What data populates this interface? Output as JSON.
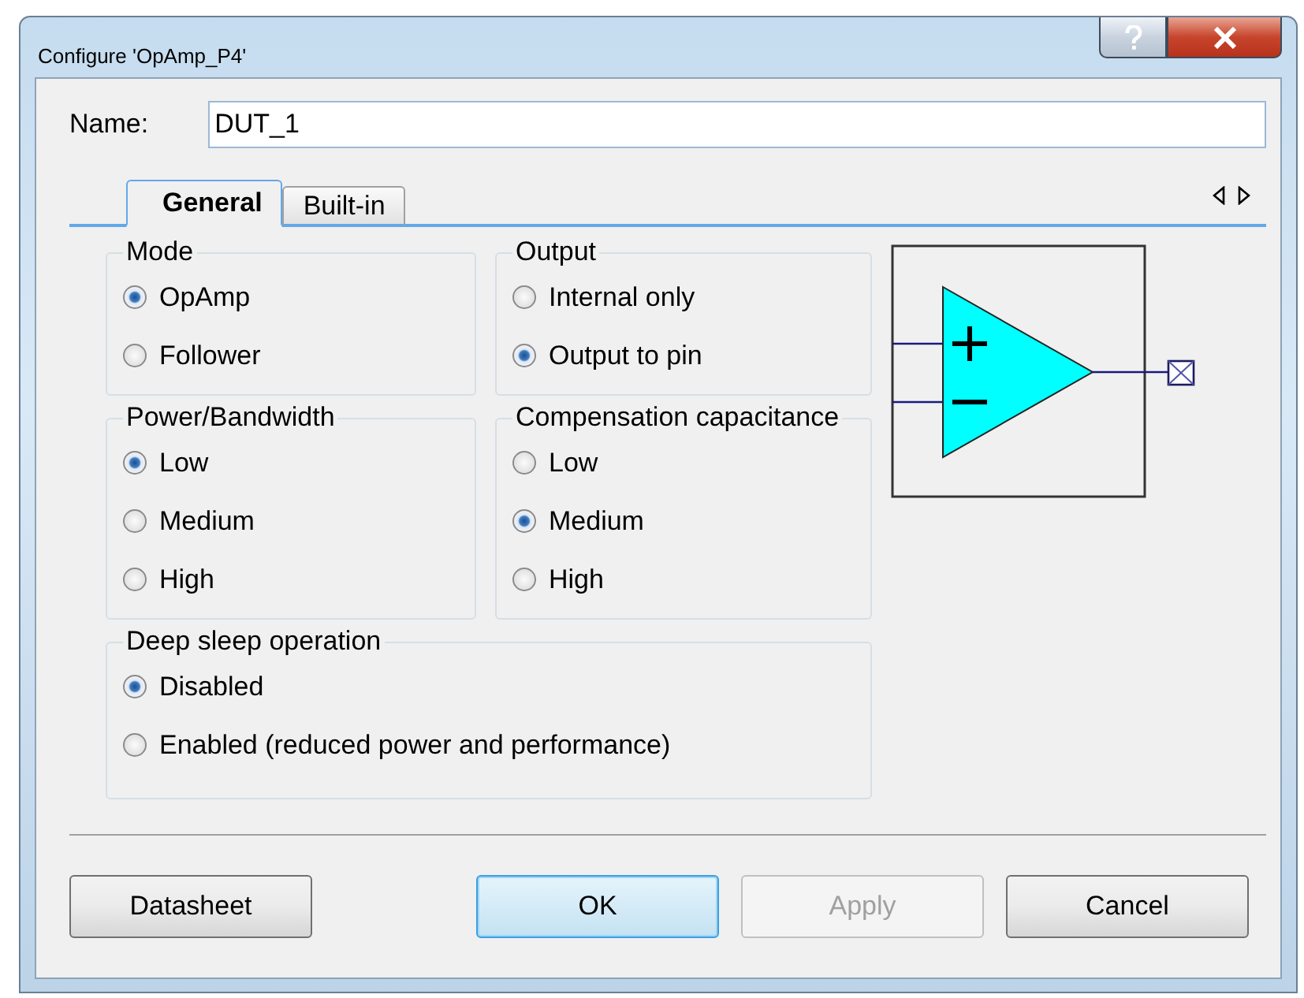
{
  "window": {
    "title": "Configure 'OpAmp_P4'"
  },
  "name_field": {
    "label": "Name:",
    "value": "DUT_1"
  },
  "tabs": [
    {
      "label": "General",
      "selected": true
    },
    {
      "label": "Built-in",
      "selected": false
    }
  ],
  "groups": [
    {
      "title": "Mode",
      "wide": false,
      "options": [
        {
          "label": "OpAmp",
          "selected": true
        },
        {
          "label": "Follower",
          "selected": false
        }
      ]
    },
    {
      "title": "Output",
      "wide": false,
      "options": [
        {
          "label": "Internal only",
          "selected": false
        },
        {
          "label": "Output to pin",
          "selected": true
        }
      ]
    },
    {
      "title": "Power/Bandwidth",
      "wide": false,
      "options": [
        {
          "label": "Low",
          "selected": true
        },
        {
          "label": "Medium",
          "selected": false
        },
        {
          "label": "High",
          "selected": false
        }
      ]
    },
    {
      "title": "Compensation capacitance",
      "wide": false,
      "options": [
        {
          "label": "Low",
          "selected": false
        },
        {
          "label": "Medium",
          "selected": true
        },
        {
          "label": "High",
          "selected": false
        }
      ]
    },
    {
      "title": "Deep sleep operation",
      "wide": true,
      "options": [
        {
          "label": "Disabled",
          "selected": true
        },
        {
          "label": "Enabled (reduced power and performance)",
          "selected": false
        }
      ]
    }
  ],
  "buttons": [
    {
      "label": "Datasheet",
      "disabled": false,
      "default": false
    },
    {
      "label": "OK",
      "disabled": false,
      "default": true
    },
    {
      "label": "Apply",
      "disabled": true,
      "default": false
    },
    {
      "label": "Cancel",
      "disabled": false,
      "default": false
    }
  ]
}
